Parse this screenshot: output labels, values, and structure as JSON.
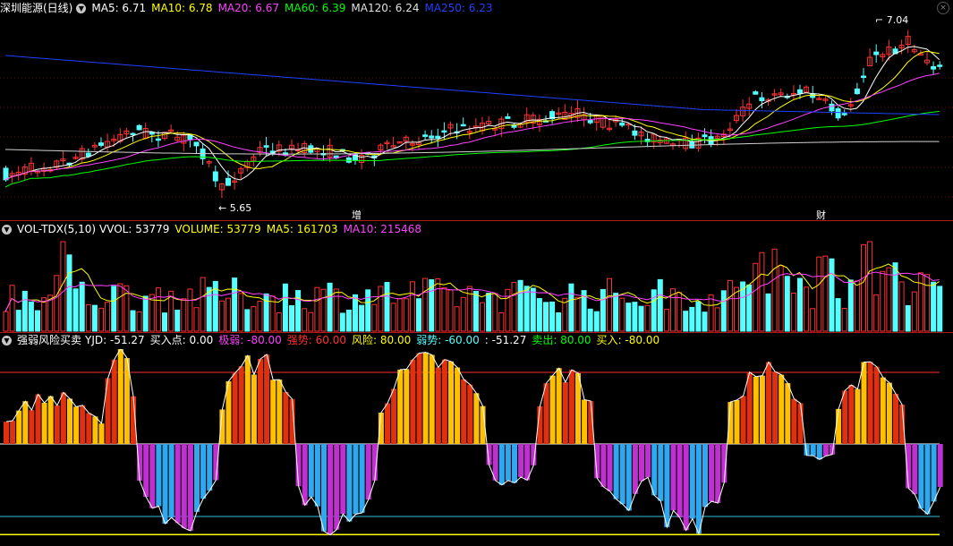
{
  "main": {
    "title": "深圳能源(日线)",
    "ma": [
      {
        "label": "MA5: 6.71",
        "color": "#ffffff"
      },
      {
        "label": "MA10: 6.78",
        "color": "#ffff00"
      },
      {
        "label": "MA20: 6.67",
        "color": "#ff40ff"
      },
      {
        "label": "MA60: 6.39",
        "color": "#00ff00"
      },
      {
        "label": "MA120: 6.24",
        "color": "#e0e0e0"
      },
      {
        "label": "MA250: 6.23",
        "color": "#2040ff"
      }
    ],
    "high_label": "7.04",
    "low_label": "5.65",
    "marker_zeng": "增",
    "marker_cai": "财"
  },
  "volume": {
    "title": "VOL-TDX(5,10)",
    "vvol": "VVOL: 53779",
    "volume": "VOLUME: 53779",
    "ma5": "MA5: 161703",
    "ma10": "MA10: 215468"
  },
  "indicator": {
    "title": "强弱风险买卖",
    "yjd": "YJD: -51.27",
    "buy_point": "买入点: 0.00",
    "very_weak": "极弱: -80.00",
    "strong": "强势: 60.00",
    "risk": "风险: 80.00",
    "weak": "弱势: -60.00",
    "blank_val": ": -51.27",
    "sell": "卖出: 80.00",
    "buy": "买入: -80.00"
  },
  "colors": {
    "up": "#ff3232",
    "down": "#54ffff",
    "ind_red": "#e03010",
    "ind_orange": "#ffc000",
    "ind_blue": "#30a8f0",
    "ind_purple": "#c030d0"
  },
  "icons": {
    "collapse": "chevron-down-icon"
  }
}
